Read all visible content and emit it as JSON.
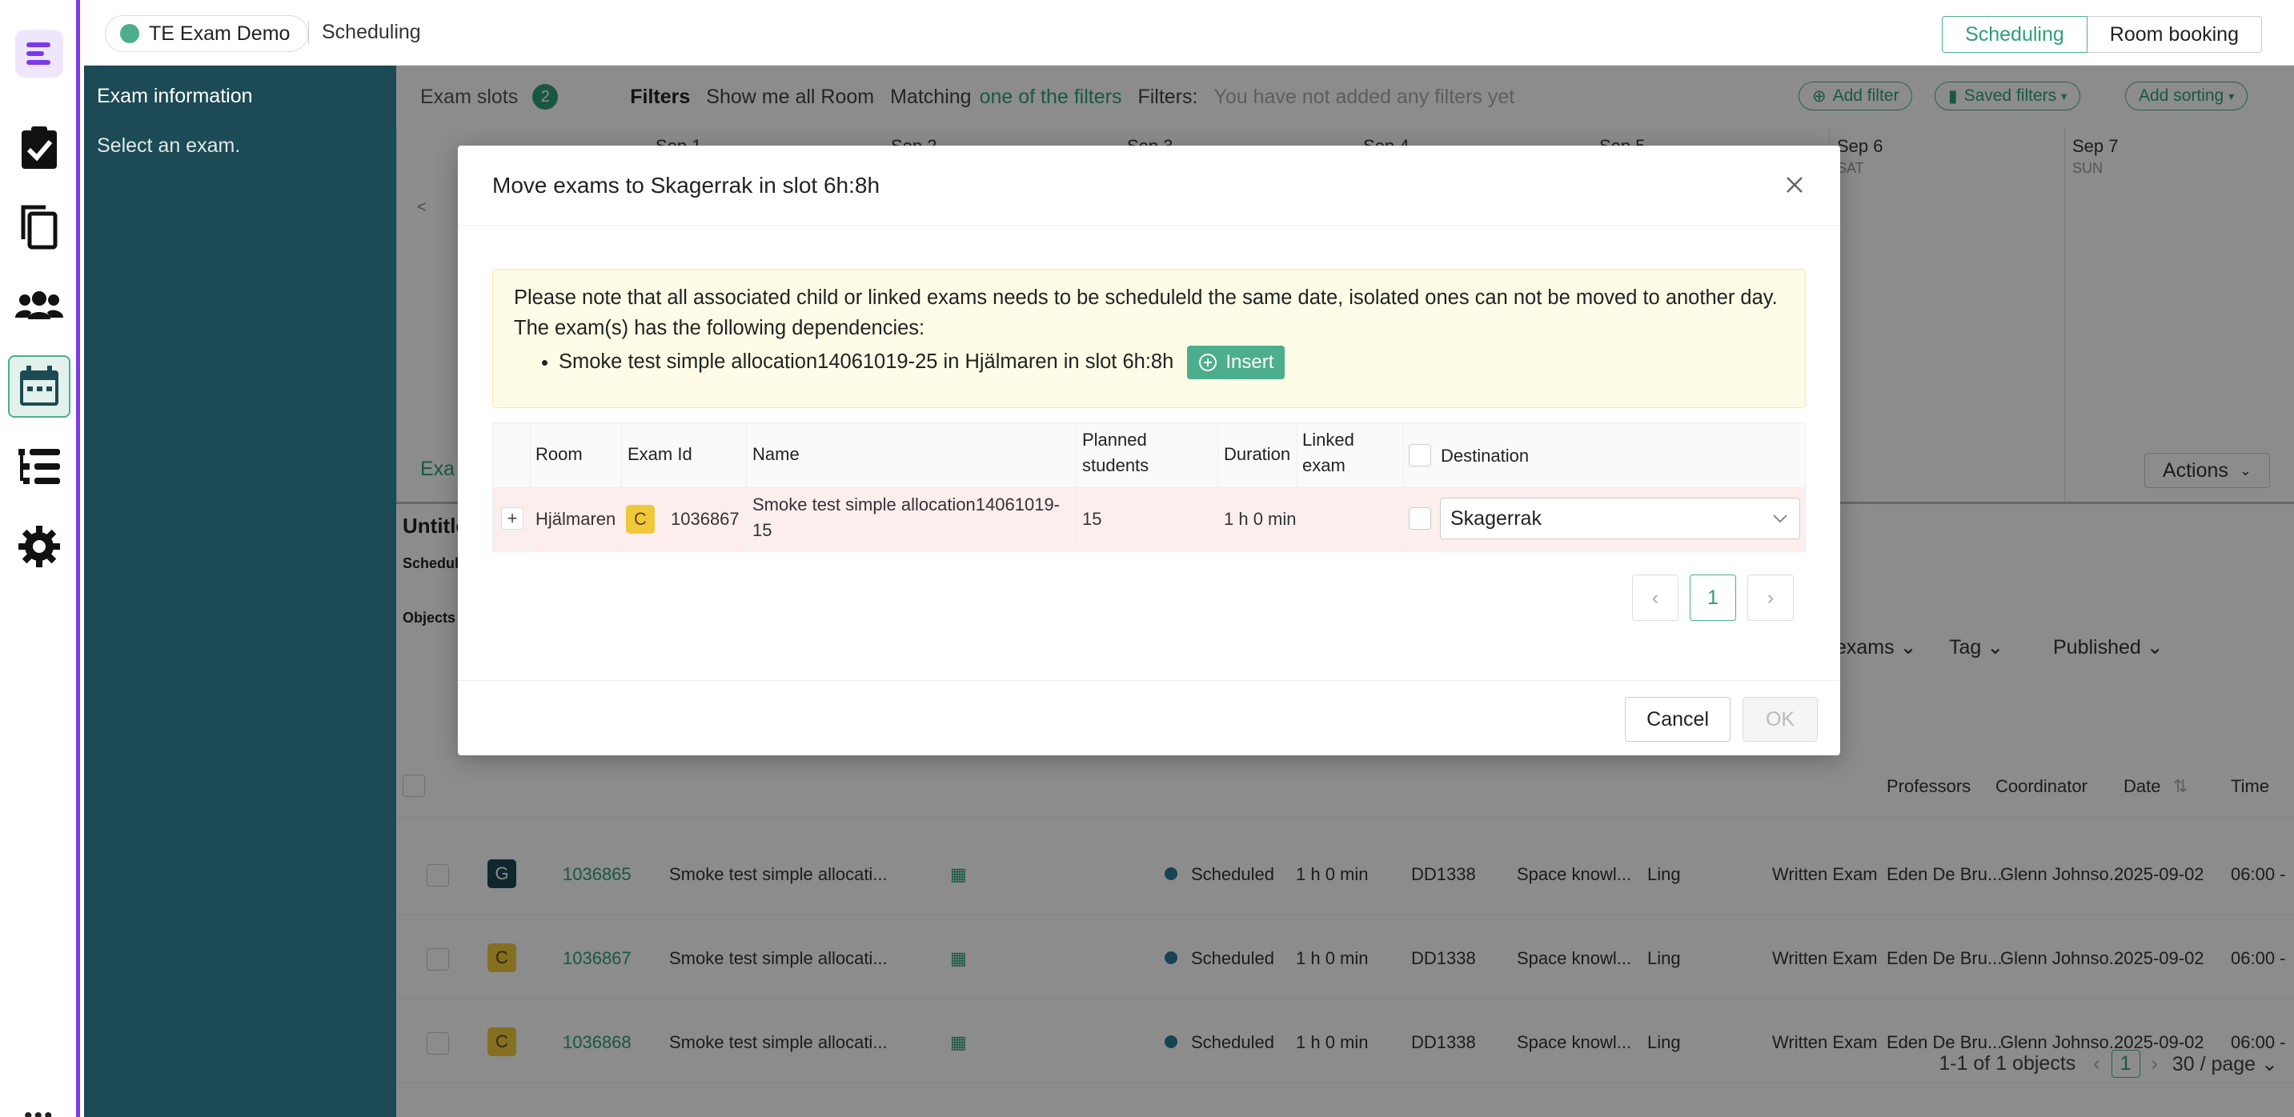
{
  "topbar": {
    "org": "TE Exam Demo",
    "crumb": "Scheduling",
    "tabs": [
      "Scheduling",
      "Room booking"
    ]
  },
  "sidebar": {
    "title": "Exam information",
    "hint": "Select an exam."
  },
  "background": {
    "exam_slots_label": "Exam slots",
    "exam_slots_count": "2",
    "filters_label": "Filters",
    "show_me_all": "Show me all Room",
    "matching": "Matching",
    "matching_mode": "one of the filters",
    "filters_colon": "Filters:",
    "no_filters": "You have not added any filters yet",
    "add_filter": "Add filter",
    "saved_filters": "Saved filters",
    "add_sorting": "Add sorting",
    "calendar_days": [
      {
        "date": "Sep 1",
        "dow": ""
      },
      {
        "date": "Sep 2",
        "dow": ""
      },
      {
        "date": "Sep 3",
        "dow": ""
      },
      {
        "date": "Sep 4",
        "dow": ""
      },
      {
        "date": "Sep 5",
        "dow": ""
      },
      {
        "date": "Sep 6",
        "dow": "SAT"
      },
      {
        "date": "Sep 7",
        "dow": "SUN"
      }
    ],
    "lower_tab": "Exa",
    "actions": "Actions",
    "untitled": "Untitle",
    "schedule_lbl": "Schedule",
    "objects_lbl": "Objects",
    "filter_dropdowns": [
      "exams",
      "Tag",
      "Published"
    ],
    "columns": [
      "Professors",
      "Coordinator",
      "Date",
      "Time"
    ],
    "rows": [
      {
        "tag": "G",
        "id": "1036865",
        "name": "Smoke test simple allocati...",
        "status": "Scheduled",
        "duration": "1 h 0 min",
        "course": "DD1338",
        "subject": "Space knowl...",
        "lang": "Ling",
        "type": "Written Exam",
        "prof": "Eden De Bru...",
        "coord": "Glenn Johnso...",
        "date": "2025-09-02",
        "time": "06:00 -"
      },
      {
        "tag": "C",
        "id": "1036867",
        "name": "Smoke test simple allocati...",
        "status": "Scheduled",
        "duration": "1 h 0 min",
        "course": "DD1338",
        "subject": "Space knowl...",
        "lang": "Ling",
        "type": "Written Exam",
        "prof": "Eden De Bru...",
        "coord": "Glenn Johnso...",
        "date": "2025-09-02",
        "time": "06:00 -"
      },
      {
        "tag": "C",
        "id": "1036868",
        "name": "Smoke test simple allocati...",
        "status": "Scheduled",
        "duration": "1 h 0 min",
        "course": "DD1338",
        "subject": "Space knowl...",
        "lang": "Ling",
        "type": "Written Exam",
        "prof": "Eden De Bru...",
        "coord": "Glenn Johnso...",
        "date": "2025-09-02",
        "time": "06:00 -"
      }
    ],
    "pager_summary": "1-1 of 1 objects",
    "pager_page": "1",
    "pager_size": "30 / page"
  },
  "modal": {
    "title": "Move exams to Skagerrak in slot 6h:8h",
    "notice": "Please note that all associated child or linked exams needs to be scheduleld the same date, isolated ones can not be moved to another day. The exam(s) has the following dependencies:",
    "dependency": "Smoke test simple allocation14061019-25 in Hjälmaren in slot 6h:8h",
    "insert_label": "Insert",
    "headers": {
      "room": "Room",
      "exam_id": "Exam Id",
      "name": "Name",
      "planned_l1": "Planned",
      "planned_l2": "students",
      "duration": "Duration",
      "linked_l1": "Linked",
      "linked_l2": "exam",
      "destination": "Destination"
    },
    "row": {
      "room": "Hjälmaren",
      "tag": "C",
      "exam_id": "1036867",
      "name_l1": "Smoke test simple allocation14061019-",
      "name_l2": "15",
      "planned": "15",
      "duration": "1 h 0 min",
      "linked": "",
      "destination": "Skagerrak"
    },
    "page": "1",
    "cancel": "Cancel",
    "ok": "OK"
  },
  "colors": {
    "accent": "#2f9e7a",
    "rail_accent": "#7c3aed",
    "sidebar_bg": "#1c4a55",
    "notice_bg": "#fefbe6",
    "row_highlight": "#fdeeee"
  }
}
